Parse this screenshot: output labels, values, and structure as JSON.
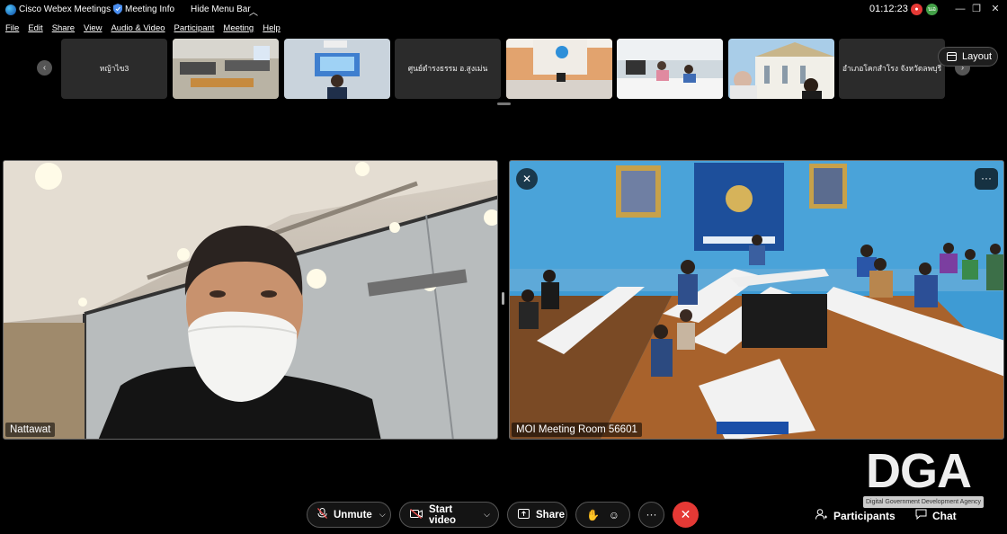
{
  "titlebar": {
    "app_title": "Cisco Webex Meetings",
    "meeting_info": "Meeting Info",
    "hide_menu": "Hide Menu Bar",
    "clock": "01:12:23",
    "rec_badge": "●",
    "avatar_initials": "นอ",
    "minimize": "—",
    "restore": "❐",
    "close": "✕"
  },
  "menu": [
    "File",
    "Edit",
    "Share",
    "View",
    "Audio & Video",
    "Participant",
    "Meeting",
    "Help"
  ],
  "filmstrip": {
    "thumbs": [
      {
        "label": "หญ้าไข3"
      },
      {
        "label": ""
      },
      {
        "label": ""
      },
      {
        "label": "ศูนย์ดำรงธรรม อ.สูงเม่น"
      },
      {
        "label": ""
      },
      {
        "label": ""
      },
      {
        "label": ""
      },
      {
        "label": "อำเภอโคกสำโรง จังหวัดลพบุรี"
      }
    ],
    "layout_label": "Layout"
  },
  "videos": {
    "left_name": "Nattawat",
    "right_name": "MOI Meeting Room 56601"
  },
  "watermark": {
    "logo": "DGA",
    "subtitle": "Digital Government Development Agency"
  },
  "controls": {
    "unmute": "Unmute",
    "start_video": "Start video",
    "share": "Share",
    "participants": "Participants",
    "chat": "Chat"
  },
  "colors": {
    "end_button": "#e53935",
    "room_wall": "#3e9bd4"
  }
}
